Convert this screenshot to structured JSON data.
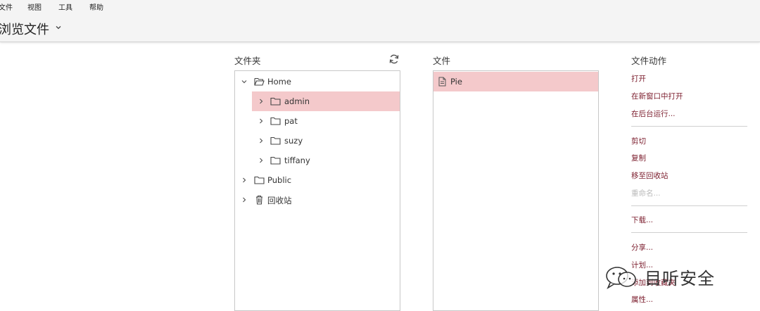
{
  "menubar": {
    "file": "文件",
    "view": "视图",
    "tools": "工具",
    "help": "帮助"
  },
  "page": {
    "title": "浏览文件"
  },
  "folders": {
    "title": "文件夹",
    "items": [
      {
        "label": "Home",
        "expanded": true
      },
      {
        "label": "admin",
        "selected": true
      },
      {
        "label": "pat"
      },
      {
        "label": "suzy"
      },
      {
        "label": "tiffany"
      },
      {
        "label": "Public"
      },
      {
        "label": "回收站"
      }
    ]
  },
  "files": {
    "title": "文件",
    "items": [
      {
        "label": "Pie",
        "selected": true
      }
    ]
  },
  "actions": {
    "title": "文件动作",
    "open": "打开",
    "open_new_window": "在新窗口中打开",
    "run_background": "在后台运行...",
    "cut": "剪切",
    "copy": "复制",
    "move_to_trash": "移至回收站",
    "rename": "重命名...",
    "download": "下载...",
    "share": "分享...",
    "schedule": "计划...",
    "add_favorite": "添加到收藏夹",
    "properties": "属性..."
  },
  "watermark": {
    "text": "目听安全"
  },
  "colors": {
    "selection": "#f4c9cb",
    "action_text": "#7b1c2c",
    "disabled_text": "#bbbbbb"
  }
}
